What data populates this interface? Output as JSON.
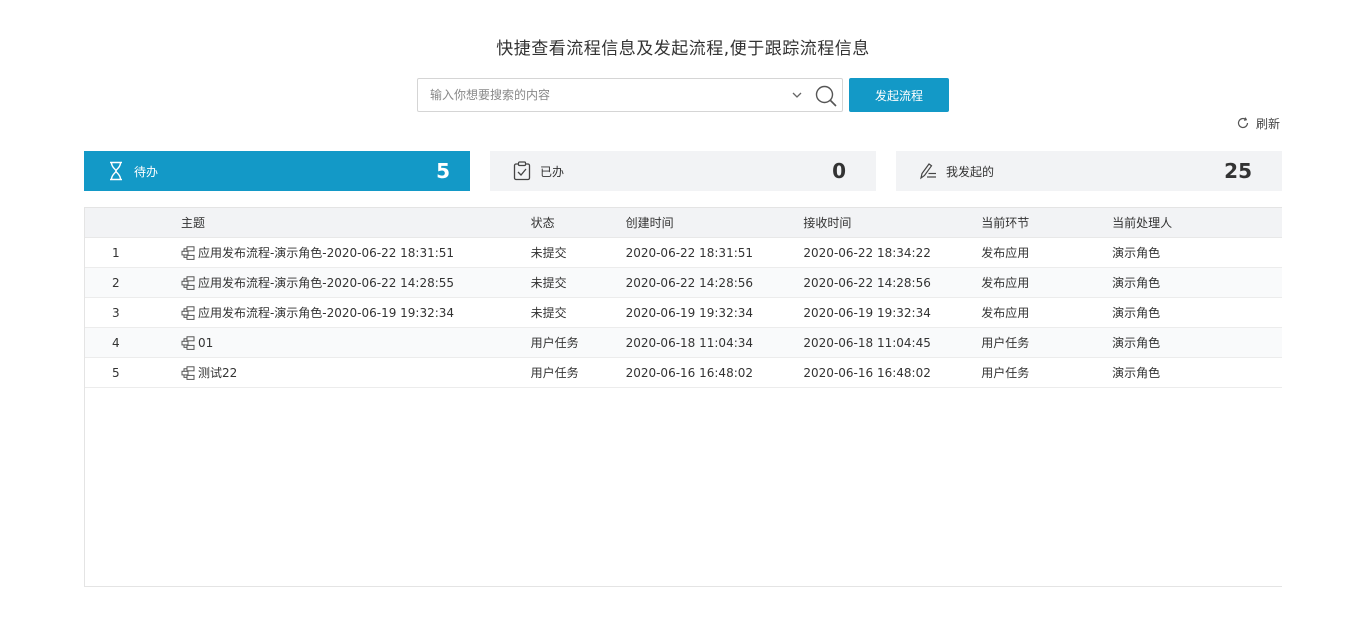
{
  "header": {
    "title": "快捷查看流程信息及发起流程,便于跟踪流程信息"
  },
  "search": {
    "placeholder": "输入你想要搜索的内容",
    "value": ""
  },
  "actions": {
    "start_label": "发起流程",
    "refresh_label": "刷新"
  },
  "cards": {
    "todo": {
      "label": "待办",
      "count": "5"
    },
    "done": {
      "label": "已办",
      "count": "0"
    },
    "mine": {
      "label": "我发起的",
      "count": "25"
    }
  },
  "table": {
    "columns": [
      "",
      "主题",
      "状态",
      "创建时间",
      "接收时间",
      "当前环节",
      "当前处理人"
    ],
    "rows": [
      {
        "no": "1",
        "subject": "应用发布流程-演示角色-2020-06-22 18:31:51",
        "status": "未提交",
        "created": "2020-06-22 18:31:51",
        "received": "2020-06-22 18:34:22",
        "step": "发布应用",
        "handler": "演示角色"
      },
      {
        "no": "2",
        "subject": "应用发布流程-演示角色-2020-06-22 14:28:55",
        "status": "未提交",
        "created": "2020-06-22 14:28:56",
        "received": "2020-06-22 14:28:56",
        "step": "发布应用",
        "handler": "演示角色"
      },
      {
        "no": "3",
        "subject": "应用发布流程-演示角色-2020-06-19 19:32:34",
        "status": "未提交",
        "created": "2020-06-19 19:32:34",
        "received": "2020-06-19 19:32:34",
        "step": "发布应用",
        "handler": "演示角色"
      },
      {
        "no": "4",
        "subject": "01",
        "status": "用户任务",
        "created": "2020-06-18 11:04:34",
        "received": "2020-06-18 11:04:45",
        "step": "用户任务",
        "handler": "演示角色"
      },
      {
        "no": "5",
        "subject": "测试22",
        "status": "用户任务",
        "created": "2020-06-16 16:48:02",
        "received": "2020-06-16 16:48:02",
        "step": "用户任务",
        "handler": "演示角色"
      }
    ]
  },
  "colors": {
    "accent": "#1399c7",
    "card_bg": "#f2f3f5"
  },
  "icons": {
    "todo": "hourglass-icon",
    "done": "clipboard-check-icon",
    "mine": "pen-edit-icon",
    "refresh": "refresh-icon",
    "search": "search-icon",
    "dropdown": "chevron-down-icon",
    "row": "flow-node-icon"
  }
}
